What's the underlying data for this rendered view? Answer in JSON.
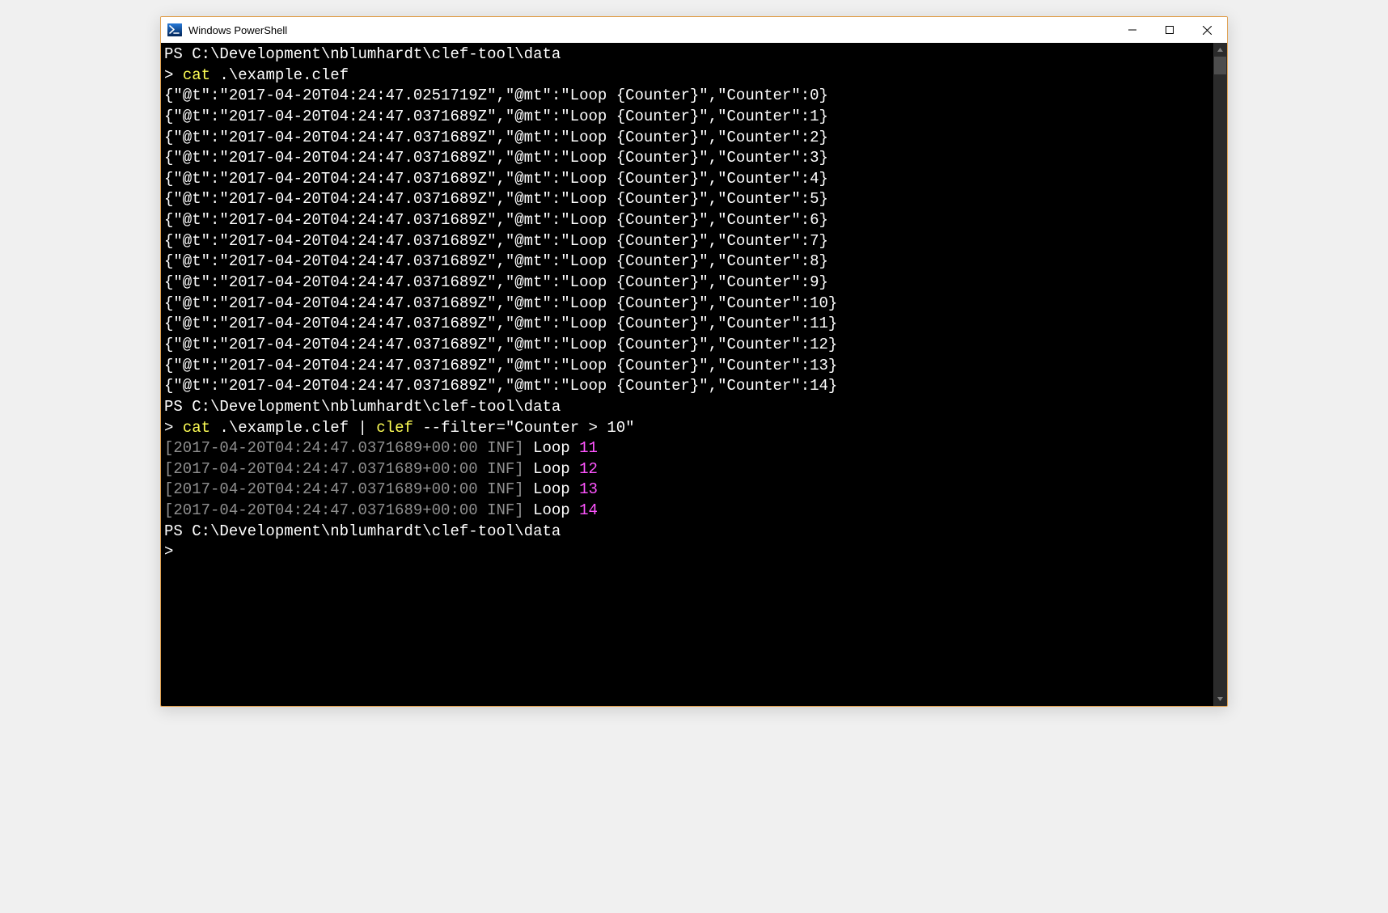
{
  "window": {
    "title": "Windows PowerShell"
  },
  "prompt_path": "PS C:\\Development\\nblumhardt\\clef-tool\\data",
  "prompt_symbol": ">",
  "commands": {
    "cmd1": "cat",
    "cmd1_arg": " .\\example.clef",
    "cmd2_cat": "cat",
    "cmd2_pipe_pre": " .\\example.clef | ",
    "cmd2_clef": "clef",
    "cmd2_args": " --filter=\"Counter > 10\""
  },
  "cat_output": [
    "{\"@t\":\"2017-04-20T04:24:47.0251719Z\",\"@mt\":\"Loop {Counter}\",\"Counter\":0}",
    "{\"@t\":\"2017-04-20T04:24:47.0371689Z\",\"@mt\":\"Loop {Counter}\",\"Counter\":1}",
    "{\"@t\":\"2017-04-20T04:24:47.0371689Z\",\"@mt\":\"Loop {Counter}\",\"Counter\":2}",
    "{\"@t\":\"2017-04-20T04:24:47.0371689Z\",\"@mt\":\"Loop {Counter}\",\"Counter\":3}",
    "{\"@t\":\"2017-04-20T04:24:47.0371689Z\",\"@mt\":\"Loop {Counter}\",\"Counter\":4}",
    "{\"@t\":\"2017-04-20T04:24:47.0371689Z\",\"@mt\":\"Loop {Counter}\",\"Counter\":5}",
    "{\"@t\":\"2017-04-20T04:24:47.0371689Z\",\"@mt\":\"Loop {Counter}\",\"Counter\":6}",
    "{\"@t\":\"2017-04-20T04:24:47.0371689Z\",\"@mt\":\"Loop {Counter}\",\"Counter\":7}",
    "{\"@t\":\"2017-04-20T04:24:47.0371689Z\",\"@mt\":\"Loop {Counter}\",\"Counter\":8}",
    "{\"@t\":\"2017-04-20T04:24:47.0371689Z\",\"@mt\":\"Loop {Counter}\",\"Counter\":9}",
    "{\"@t\":\"2017-04-20T04:24:47.0371689Z\",\"@mt\":\"Loop {Counter}\",\"Counter\":10}",
    "{\"@t\":\"2017-04-20T04:24:47.0371689Z\",\"@mt\":\"Loop {Counter}\",\"Counter\":11}",
    "{\"@t\":\"2017-04-20T04:24:47.0371689Z\",\"@mt\":\"Loop {Counter}\",\"Counter\":12}",
    "{\"@t\":\"2017-04-20T04:24:47.0371689Z\",\"@mt\":\"Loop {Counter}\",\"Counter\":13}",
    "{\"@t\":\"2017-04-20T04:24:47.0371689Z\",\"@mt\":\"Loop {Counter}\",\"Counter\":14}"
  ],
  "filtered_output": [
    {
      "ts_open": "[",
      "ts": "2017-04-20T04:24:47.0371689+00:00 INF",
      "ts_close": "]",
      "label": " Loop ",
      "val": "11"
    },
    {
      "ts_open": "[",
      "ts": "2017-04-20T04:24:47.0371689+00:00 INF",
      "ts_close": "]",
      "label": " Loop ",
      "val": "12"
    },
    {
      "ts_open": "[",
      "ts": "2017-04-20T04:24:47.0371689+00:00 INF",
      "ts_close": "]",
      "label": " Loop ",
      "val": "13"
    },
    {
      "ts_open": "[",
      "ts": "2017-04-20T04:24:47.0371689+00:00 INF",
      "ts_close": "]",
      "label": " Loop ",
      "val": "14"
    }
  ]
}
